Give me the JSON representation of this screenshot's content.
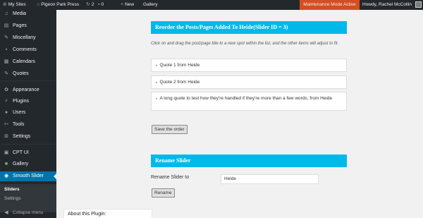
{
  "admin_bar": {
    "my_sites": "My Sites",
    "site_name": "Pigeon Park Press",
    "updates_count": "2",
    "comments_count": "0",
    "new_label": "New",
    "gallery_label": "Gallery",
    "maintenance": "Maintenance Mode Active",
    "howdy": "Howdy, Rachel McCollin"
  },
  "sidebar": {
    "items": [
      {
        "label": "Media",
        "icon": "media-icon"
      },
      {
        "label": "Pages",
        "icon": "pages-icon"
      },
      {
        "label": "Miscellany",
        "icon": "pin-icon"
      },
      {
        "label": "Comments",
        "icon": "comments-icon"
      },
      {
        "label": "Calendars",
        "icon": "calendar-icon"
      },
      {
        "label": "Quotes",
        "icon": "pin-icon"
      },
      {
        "label": "Appearance",
        "icon": "appearance-icon"
      },
      {
        "label": "Plugins",
        "icon": "plugins-icon"
      },
      {
        "label": "Users",
        "icon": "users-icon"
      },
      {
        "label": "Tools",
        "icon": "tools-icon"
      },
      {
        "label": "Settings",
        "icon": "settings-icon"
      },
      {
        "label": "CPT UI",
        "icon": "cptui-icon"
      },
      {
        "label": "Gallery",
        "icon": "gallery-icon"
      },
      {
        "label": "Smooth Slider",
        "icon": "smooth-slider-icon"
      }
    ],
    "submenu": [
      "Sliders",
      "Settings"
    ],
    "collapse": "Collapse menu"
  },
  "main": {
    "reorder_title": "Reorder the Posts/Pages Added To Heide(Slider ID = 3)",
    "instructions": "Click on and drag the post/page title to a new spot within the list, and the other items will adjust to fit.",
    "sort_items": [
      "Quote 1 from Heide",
      "Quote 2 from Heide",
      "A long quote to test how they're handled if they're more than a few words, from Heide"
    ],
    "save_button": "Save the order",
    "rename_title": "Rename Slider",
    "rename_label": "Rename Slider to",
    "rename_value": "Heide",
    "rename_button": "Rename",
    "about_title": "About this Plugin:"
  },
  "colors": {
    "admin_bar_bg": "#23282d",
    "maintenance_bg": "#d54e21",
    "current_menu_bg": "#0073aa",
    "section_header_bg": "#00b9eb",
    "page_bg": "#f1f1f1"
  }
}
